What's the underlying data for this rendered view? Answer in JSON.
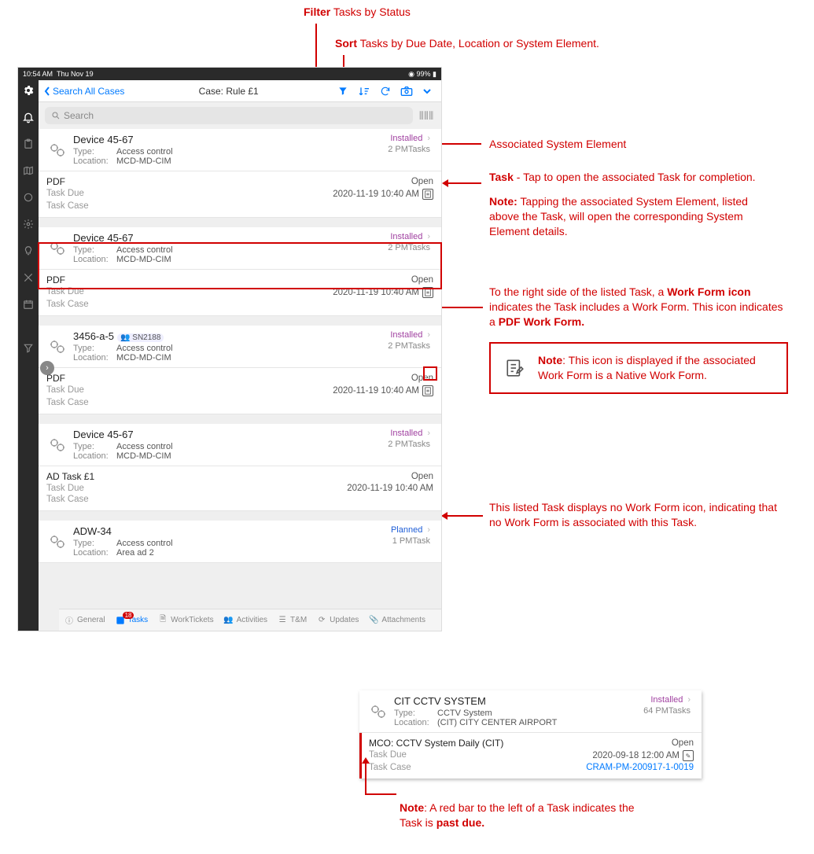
{
  "annotations": {
    "filter": "Tasks by Status",
    "filter_b": "Filter",
    "sort": "Tasks by Due Date, Location or System Element.",
    "sort_b": "Sort",
    "assoc": "Associated System Element",
    "task_line1_b": "Task",
    "task_line1": " - Tap to open the associated Task for completion.",
    "task_note_b": "Note:",
    "task_note": " Tapping the associated System Element, listed above the Task, will open the corresponding System Element details.",
    "wf_line1a": "To the right side of the listed Task, a ",
    "wf_line1b": "Work Form icon",
    "wf_line1c": " indicates the Task includes a Work Form. This icon indicates a ",
    "wf_line1d": "PDF Work Form.",
    "nativebox_b": "Note",
    "nativebox_rest": ": This icon is displayed if the associated Work Form is a Native Work Form.",
    "nowf": "This listed Task displays no Work Form icon, indicating that no Work Form is associated with this Task.",
    "pastdue_b": "Note",
    "pastdue_mid": ": A red bar to the left of a Task indicates the Task is ",
    "pastdue_end": "past due."
  },
  "status_bar": {
    "time": "10:54 AM",
    "date": "Thu Nov 19",
    "battery": "◉ 99% ▮"
  },
  "topbar": {
    "back": "Search All Cases",
    "title": "Case: Rule £1"
  },
  "search_placeholder": "Search",
  "labels": {
    "type": "Type:",
    "location": "Location:",
    "task_due": "Task Due",
    "task_case": "Task Case"
  },
  "items": [
    {
      "name": "Device 45-67",
      "type": "Access control",
      "location": "MCD-MD-CIM",
      "status": "Installed",
      "statusClass": "status-installed",
      "pm": "2 PMTasks",
      "task": {
        "name": "PDF",
        "state": "Open",
        "due": "2020-11-19 10:40 AM",
        "pdf": true
      }
    },
    {
      "name": "Device 45-67",
      "type": "Access control",
      "location": "MCD-MD-CIM",
      "status": "Installed",
      "statusClass": "status-installed",
      "pm": "2 PMTasks",
      "task": {
        "name": "PDF",
        "state": "Open",
        "due": "2020-11-19 10:40 AM",
        "pdf": true
      }
    },
    {
      "name": "3456-a-5",
      "badge": "SN2188",
      "type": "Access control",
      "location": "MCD-MD-CIM",
      "status": "Installed",
      "statusClass": "status-installed",
      "pm": "2 PMTasks",
      "task": {
        "name": "PDF",
        "state": "Open",
        "due": "2020-11-19 10:40 AM",
        "pdf": true
      }
    },
    {
      "name": "Device 45-67",
      "type": "Access control",
      "location": "MCD-MD-CIM",
      "status": "Installed",
      "statusClass": "status-installed",
      "pm": "2 PMTasks",
      "task": {
        "name": "AD Task £1",
        "state": "Open",
        "due": "2020-11-19 10:40 AM",
        "pdf": false
      }
    },
    {
      "name": "ADW-34",
      "type": "Access control",
      "location": "Area ad 2",
      "status": "Planned",
      "statusClass": "status-planned",
      "pm": "1 PMTask"
    }
  ],
  "bottom_tabs": {
    "general": "General",
    "tasks": "Tasks",
    "tasks_badge": "18",
    "work": "WorkTickets",
    "activities": "Activities",
    "tm": "T&M",
    "updates": "Updates",
    "attachments": "Attachments"
  },
  "mini": {
    "name": "CIT CCTV SYSTEM",
    "type": "CCTV System",
    "location": "(CIT) CITY CENTER AIRPORT",
    "status": "Installed",
    "pm": "64 PMTasks",
    "task_name": "MCO: CCTV System Daily (CIT)",
    "task_state": "Open",
    "task_due": "2020-09-18 12:00 AM",
    "task_case": "CRAM-PM-200917-1-0019"
  }
}
